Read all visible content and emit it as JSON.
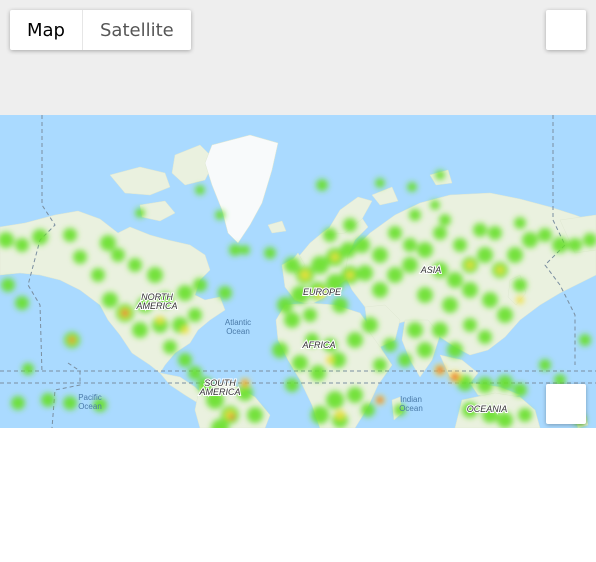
{
  "map_type_control": {
    "map_label": "Map",
    "satellite_label": "Satellite",
    "selected": "Map"
  },
  "map": {
    "colors": {
      "ocean": "#aadaff",
      "land": "#eaf1df",
      "ice": "#f8fafb",
      "heat_low": "#66e02a",
      "heat_mid": "#f0e040",
      "heat_high": "#e8323a"
    },
    "labels": {
      "north_america": [
        "NORTH",
        "AMERICA"
      ],
      "south_america": [
        "SOUTH",
        "AMERICA"
      ],
      "europe": "EUROPE",
      "africa": "AFRICA",
      "asia": "ASIA",
      "oceania": "OCEANIA",
      "atlantic": [
        "Atlantic",
        "Ocean"
      ],
      "indian": [
        "Indian",
        "Ocean"
      ],
      "pacific": [
        "Pacific",
        "Ocean"
      ]
    }
  },
  "icons": {
    "fullscreen": "fullscreen-icon",
    "zoom": "zoom-icon"
  }
}
